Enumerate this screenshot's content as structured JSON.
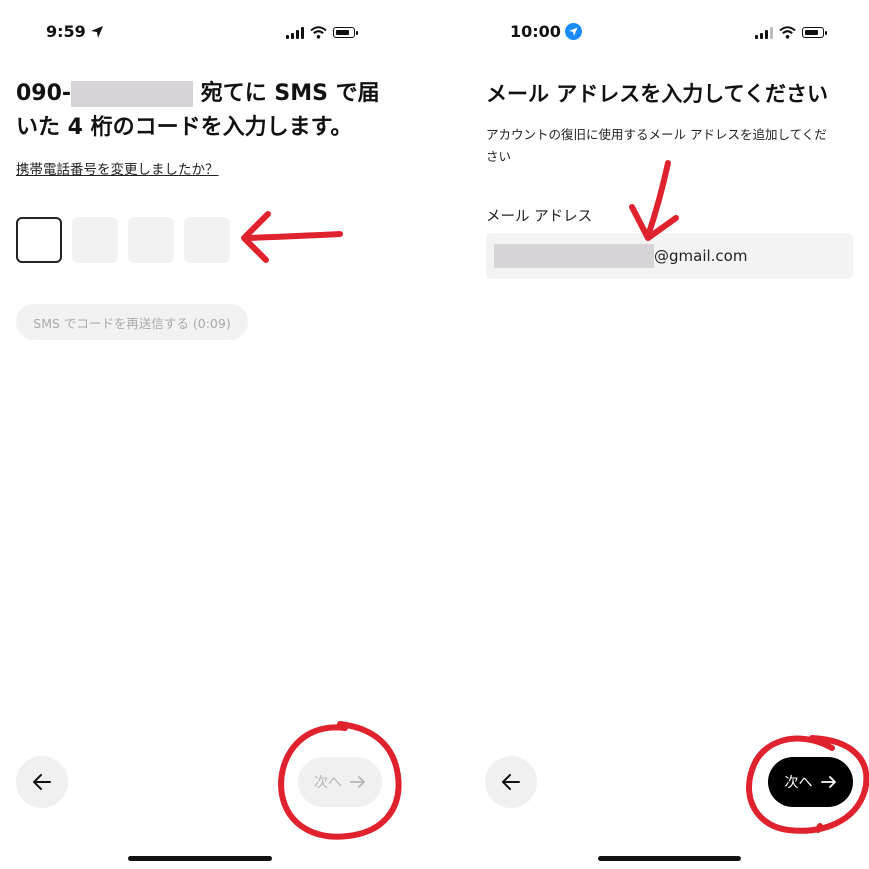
{
  "left": {
    "status": {
      "time": "9:59"
    },
    "title_prefix": "090-",
    "title_line1_suffix": "宛てに SMS で届",
    "title_line2": "いた 4 桁のコードを入力します。",
    "change_number_link": "携帯電話番号を変更しましたか？",
    "code_boxes": [
      "",
      "",
      "",
      ""
    ],
    "resend_label": "SMS でコードを再送信する (0:09)",
    "next_label": "次へ"
  },
  "right": {
    "status": {
      "time": "10:00"
    },
    "title": "メール アドレスを入力してください",
    "subtitle_line1": "アカウントの復旧に使用するメール アドレスを追加してくだ",
    "subtitle_line2": "さい",
    "email_label": "メール アドレス",
    "email_suffix": "@gmail.com",
    "next_label": "次へ"
  },
  "colors": {
    "annotation_red": "#e0222e",
    "active_button": "#000000",
    "disabled_button": "#f0f0f0"
  },
  "icons": [
    "location-arrow-icon",
    "signal-icon",
    "wifi-icon",
    "battery-icon",
    "arrow-left-icon",
    "arrow-right-icon"
  ]
}
